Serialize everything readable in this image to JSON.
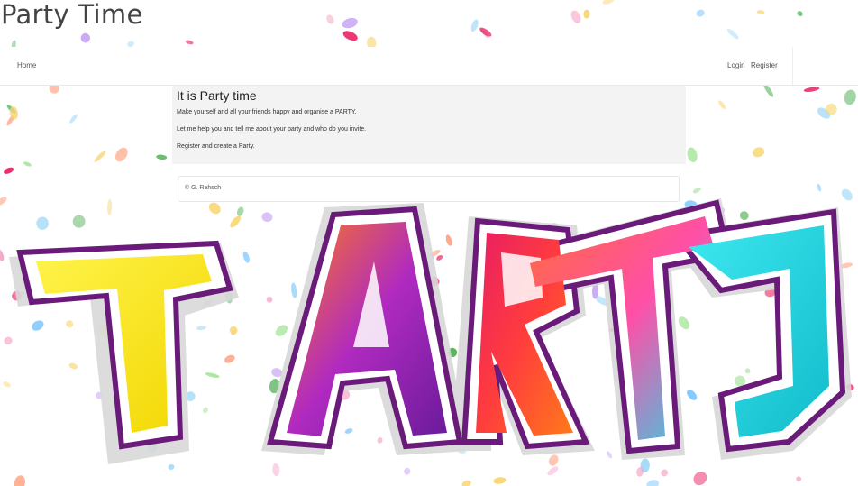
{
  "site": {
    "title": "Party Time"
  },
  "nav": {
    "home_label": "Home",
    "login_label": "Login",
    "register_label": "Register"
  },
  "intro": {
    "heading": "It is Party time",
    "paragraphs": [
      "Make yourself and all your friends happy and organise a PARTY.",
      "Let me help you and tell me about your party and who do you invite.",
      "Register and create a Party."
    ]
  },
  "footer": {
    "text": "© G. Rahsch"
  },
  "art": {
    "word": "PARTY",
    "colors": [
      "#ffef00",
      "#9c27b0",
      "#ff5722",
      "#ff4081",
      "#26e0e8",
      "#1ec8d6"
    ],
    "confetti_colors": [
      "#9fd8f8",
      "#f4a4c8",
      "#a6e39a",
      "#f9d56e",
      "#c9a7f5",
      "#7ec8ff",
      "#ff9a76",
      "#4caf50",
      "#e91e63"
    ]
  }
}
